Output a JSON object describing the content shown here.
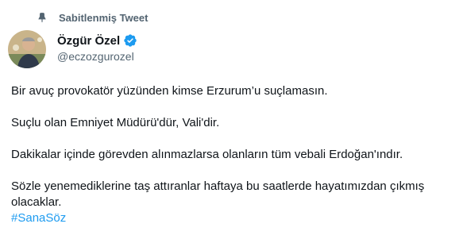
{
  "pinned": {
    "label": "Sabitlenmiş Tweet"
  },
  "author": {
    "name": "Özgür Özel",
    "handle": "@eczozgurozel",
    "verified": true
  },
  "tweet": {
    "paragraphs": [
      "Bir avuç provokatör yüzünden kimse Erzurum’u suçlamasın.",
      "Suçlu olan Emniyet Müdürü'dür, Vali'dir.",
      "Dakikalar içinde görevden alınmazlarsa olanların tüm vebali Erdoğan'ındır.",
      "Sözle yenemediklerine taş attıranlar haftaya bu saatlerde hayatımızdan çıkmış olacaklar."
    ],
    "hashtag": "#SanaSöz"
  },
  "colors": {
    "link": "#1d9bf0",
    "secondary_text": "#536471",
    "verified_badge": "#1d9bf0"
  },
  "icons": {
    "pin": "pin-icon",
    "verified": "verified-badge-icon"
  }
}
